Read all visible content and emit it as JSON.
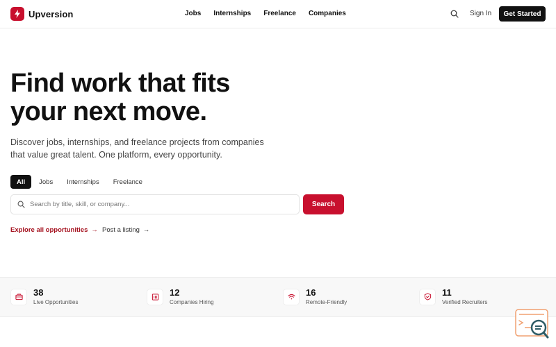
{
  "brand": {
    "name": "Upversion",
    "accent": "#c8102e"
  },
  "nav": {
    "items": [
      {
        "label": "Jobs"
      },
      {
        "label": "Internships"
      },
      {
        "label": "Freelance"
      },
      {
        "label": "Companies"
      }
    ],
    "sign_in": "Sign In",
    "get_started": "Get Started"
  },
  "hero": {
    "title_line1": "Find work that fits",
    "title_line2": "your next move.",
    "subtitle_line1": "Discover jobs, internships, and freelance projects from companies",
    "subtitle_line2": "that value great talent. One platform, every opportunity."
  },
  "filters": {
    "tabs": [
      {
        "label": "All",
        "active": true
      },
      {
        "label": "Jobs",
        "active": false
      },
      {
        "label": "Internships",
        "active": false
      },
      {
        "label": "Freelance",
        "active": false
      }
    ]
  },
  "search": {
    "placeholder": "Search by title, skill, or company...",
    "value": "",
    "button_label": "Search"
  },
  "links": {
    "explore": "Explore all opportunities",
    "post": "Post a listing"
  },
  "stats": [
    {
      "value": "38",
      "label": "Live Opportunities",
      "icon": "briefcase-icon"
    },
    {
      "value": "12",
      "label": "Companies Hiring",
      "icon": "building-icon"
    },
    {
      "value": "16",
      "label": "Remote-Friendly",
      "icon": "wifi-icon"
    },
    {
      "value": "11",
      "label": "Verified Recruiters",
      "icon": "shield-check-icon"
    }
  ]
}
